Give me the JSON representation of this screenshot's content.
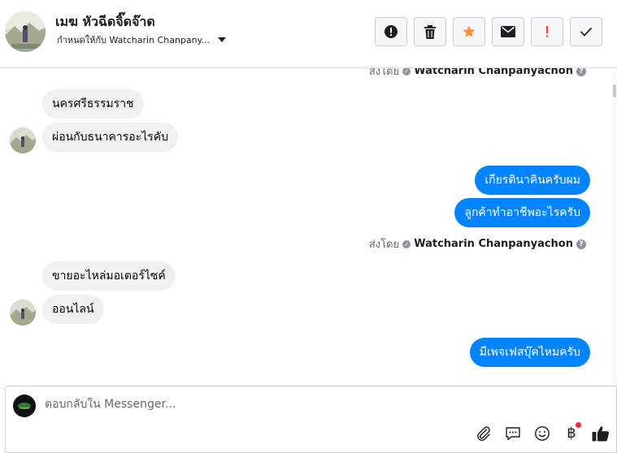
{
  "header": {
    "contact_name": "เมฆ หัวฉีดจิ๊ดจ๊าด",
    "assigned_to": "กำหนดให้กับ Watcharin Chanpany...",
    "actions": [
      {
        "name": "report-button",
        "icon": "exclamation-circle-icon"
      },
      {
        "name": "delete-button",
        "icon": "trash-icon"
      },
      {
        "name": "star-button",
        "icon": "star-icon",
        "color": "#f7923a"
      },
      {
        "name": "mark-unread-button",
        "icon": "envelope-icon"
      },
      {
        "name": "follow-up-button",
        "icon": "exclamation-icon",
        "color": "#fa3e3e"
      },
      {
        "name": "mark-done-button",
        "icon": "check-icon"
      }
    ]
  },
  "conversation": {
    "sent_by_prefix": "ส่งโดย",
    "agent_name": "Watcharin Chanpanyachon",
    "messages": [
      {
        "direction": "in",
        "text": "นครศรีธรรมราช"
      },
      {
        "direction": "in",
        "text": "ผ่อนกับธนาคารอะไรคับ"
      },
      {
        "direction": "out",
        "text": "เกียรตินาคินครับผม"
      },
      {
        "direction": "out",
        "text": "ลูกค้าทำอาชีพอะไรครับ"
      },
      {
        "direction": "in",
        "text": "ขายอะไหล่มอเตอร์ไซค์"
      },
      {
        "direction": "in",
        "text": "ออนไลน์"
      },
      {
        "direction": "out",
        "text": "มีเพจเฟสบุ๊คไหมครับ"
      }
    ]
  },
  "composer": {
    "placeholder": "ตอบกลับใน Messenger...",
    "value": "",
    "tools": [
      "paperclip-icon",
      "saved-reply-icon",
      "emoji-icon",
      "baht-payment-icon",
      "like-icon"
    ]
  },
  "colors": {
    "outgoing_bubble": "#0084ff",
    "incoming_bubble": "#f0f0f0",
    "star": "#f7923a",
    "alert": "#fa3e3e"
  }
}
